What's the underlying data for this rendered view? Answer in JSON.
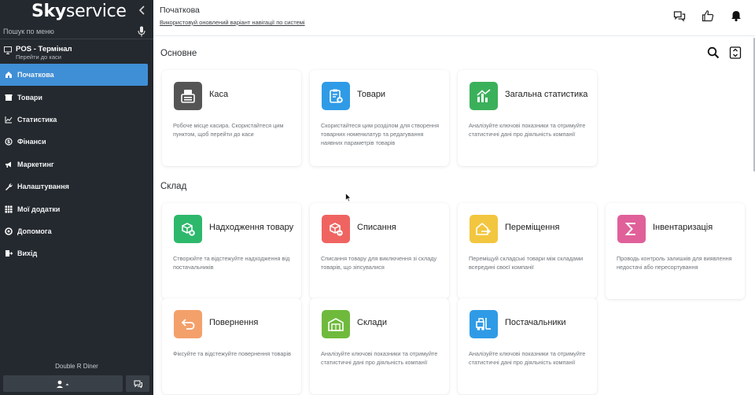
{
  "sidebar": {
    "logo_bold": "Sky",
    "logo_light": "service",
    "search_placeholder": "Пошук по меню",
    "pos": {
      "title": "POS - Термінал",
      "subtitle": "Перейти до каси"
    },
    "items": [
      {
        "label": "Початкова",
        "icon": "home-icon",
        "active": true
      },
      {
        "label": "Товари",
        "icon": "box-icon"
      },
      {
        "label": "Статистика",
        "icon": "chart-icon"
      },
      {
        "label": "Фінанси",
        "icon": "coin-icon"
      },
      {
        "label": "Маркетинг",
        "icon": "megaphone-icon"
      },
      {
        "label": "Налаштування",
        "icon": "wrench-icon"
      },
      {
        "label": "Мої додатки",
        "icon": "grid-icon"
      },
      {
        "label": "Допомога",
        "icon": "help-icon"
      },
      {
        "label": "Вихід",
        "icon": "exit-icon"
      }
    ],
    "business_name": "Double R Diner"
  },
  "topbar": {
    "title": "Початкова",
    "notice": "Використовуй оновлений варіант навігації по системі"
  },
  "sections": {
    "basic": "Основне",
    "warehouse": "Склад"
  },
  "cards": {
    "kasa": {
      "title": "Каса",
      "desc": "Робоче місце касира. Скористайтеся цим пунктом, щоб перейти до каси",
      "color": "#555555"
    },
    "tovary": {
      "title": "Товари",
      "desc": "Скористайтеся цим розділом для створення товарних номенклатур та редагування наявних параметрів товарів",
      "color": "#2f9be6"
    },
    "stat": {
      "title": "Загальна статистика",
      "desc": "Аналізуйте ключові показники та отримуйте статистичні дані про діяльність компанії",
      "color": "#3bb05a"
    },
    "nadhodzh": {
      "title": "Надходження товару",
      "desc": "Створюйте та відстежуйте надходження від постачальників",
      "color": "#2db86c"
    },
    "spysannia": {
      "title": "Списання",
      "desc": "Списання товару для виключення зі складу товарів, що зіпсувалися",
      "color": "#ef6461"
    },
    "peremisch": {
      "title": "Переміщення",
      "desc": "Переміщуй складські товари між складами всередині своєї компанії",
      "color": "#f3c63f"
    },
    "inventar": {
      "title": "Інвентаризація",
      "desc": "Проводь контроль залишків для виявлення недостачі або пересортування",
      "color": "#e0609a"
    },
    "povernennia": {
      "title": "Повернення",
      "desc": "Фіксуйте та відстежуйте повернення товарів",
      "color": "#f4a06a"
    },
    "sklady": {
      "title": "Склади",
      "desc": "Аналізуйте ключові показники та отримуйте статистичні дані про діяльність компанії",
      "color": "#6fba3c"
    },
    "postach": {
      "title": "Постачальники",
      "desc": "Аналізуйте ключові показники та отримуйте статистичні дані про діяльність компанії",
      "color": "#2f9be6"
    }
  }
}
